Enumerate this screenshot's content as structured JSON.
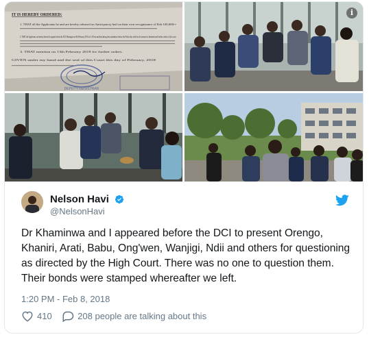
{
  "photos": {
    "document_lines": [
      "IT IS HEREBY ORDERED:",
      "1. THAT all the Applicants be and are hereby released on Anticipatory bail on their own recognizance of Ksh 100,000/=",
      "2. THAT the Applicants are hereby directed to appear before the DCI Mazingira on 8th February 2018 at 11.00 am and that during their attendance before the Police they shall not be arrested or detained until further orders of this court.",
      "3. THAT mention on 13th February 2018 for further orders.",
      "GIVEN under my hand and the seal of this Court this day of February, 2018"
    ],
    "stamp_text": "DEPUTY REGISTRAR"
  },
  "author": {
    "name": "Nelson Havi",
    "handle": "@NelsonHavi"
  },
  "tweet": {
    "text": "Dr Khaminwa and I appeared before the DCI to present Orengo, Khaniri, Arati, Babu, Ong'wen, Wanjigi, Ndii and others for questioning as directed by the High Court. There was no one to question them. Their bonds were stamped whereafter we left.",
    "timestamp": "1:20 PM - Feb 8, 2018"
  },
  "actions": {
    "likes": "410",
    "replies_label": "208 people are talking about this"
  },
  "colors": {
    "twitter_blue": "#1da1f2",
    "text_primary": "#14171a",
    "text_secondary": "#657786",
    "border": "#e1e8ed"
  },
  "icons": {
    "info": "info-icon",
    "verified": "verified-badge-icon",
    "brand": "twitter-bird-icon",
    "like": "heart-icon",
    "reply": "speech-bubble-icon"
  }
}
